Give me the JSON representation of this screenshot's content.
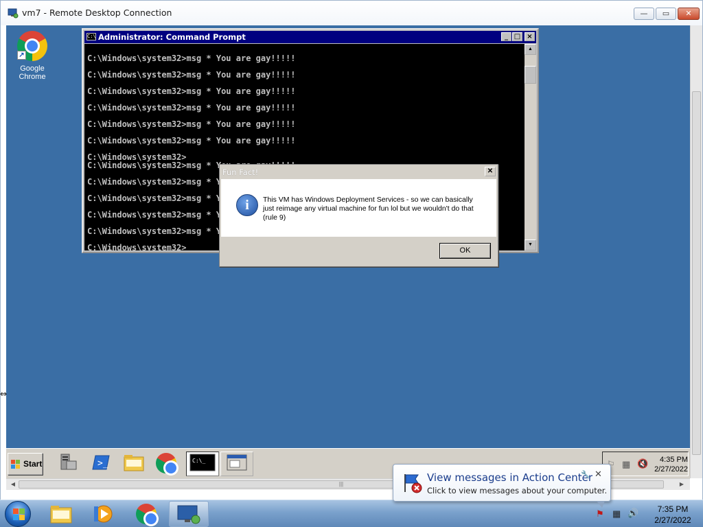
{
  "rdp": {
    "title": "vm7 - Remote Desktop Connection",
    "min_label": "—",
    "max_label": "▭",
    "close_label": "✕"
  },
  "desktop": {
    "icons": [
      {
        "label": "Google Chrome",
        "icon": "chrome-icon"
      }
    ]
  },
  "cmd": {
    "title": "Administrator: Command Prompt",
    "lines": [
      "",
      "C:\\Windows\\system32>msg * You are gay!!!!!",
      "",
      "C:\\Windows\\system32>msg * You are gay!!!!!",
      "",
      "C:\\Windows\\system32>msg * You are gay!!!!!",
      "",
      "C:\\Windows\\system32>msg * You are gay!!!!!",
      "",
      "C:\\Windows\\system32>msg * You are gay!!!!!",
      "",
      "C:\\Windows\\system32>msg * You are gay!!!!!",
      "",
      "C:\\Windows\\system32>",
      "C:\\Windows\\system32>msg * You are gay!!!!!",
      "",
      "C:\\Windows\\system32>msg * You are gay!!!!!",
      "",
      "C:\\Windows\\system32>msg * You are gay!!!!!",
      "",
      "C:\\Windows\\system32>msg * You are gay!!!!!",
      "",
      "C:\\Windows\\system32>msg * You are gay!!!!!",
      "",
      "C:\\Windows\\system32>_"
    ]
  },
  "msgbox": {
    "title": "Fun Fact!",
    "message": "This VM has Windows Deployment Services - so we can basically just reimage any virtual machine for fun lol but we wouldn't do that (rule 9)",
    "ok_label": "OK",
    "close_label": "✕"
  },
  "remote_taskbar": {
    "start_label": "Start",
    "time": "4:35 PM",
    "date": "2/27/2022"
  },
  "local_taskbar": {
    "time": "7:35 PM",
    "date": "2/27/2022"
  },
  "balloon": {
    "title": "View messages in Action Center",
    "subtitle": "Click to view messages about your computer.",
    "close_label": "✕"
  },
  "colors": {
    "remote_desktop": "#3a6ea5",
    "cmd_title": "#000080",
    "w7_taskbar": "#7aa1cc"
  }
}
